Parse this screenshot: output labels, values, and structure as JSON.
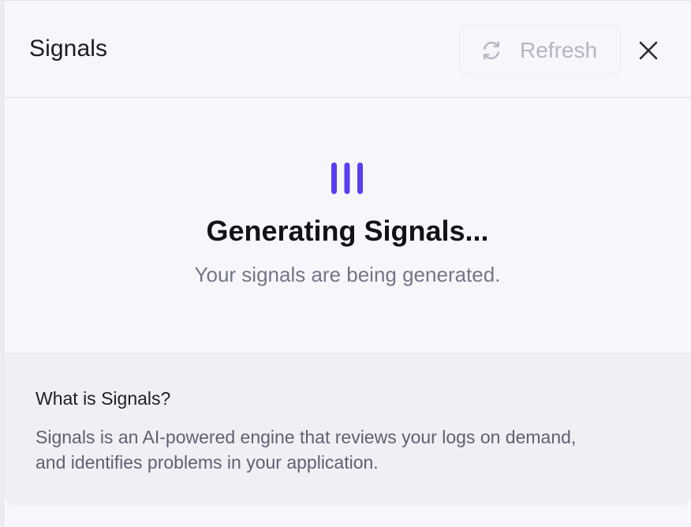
{
  "header": {
    "title": "Signals",
    "refresh_label": "Refresh",
    "refresh_icon": "refresh-icon",
    "close_icon": "close-icon"
  },
  "loading": {
    "title": "Generating Signals...",
    "subtitle": "Your signals are being generated.",
    "loader_color": "#5b3df0"
  },
  "info": {
    "title": "What is Signals?",
    "line1": "Signals is an AI-powered engine that reviews your logs on demand,",
    "line2": "and identifies problems in your application."
  }
}
